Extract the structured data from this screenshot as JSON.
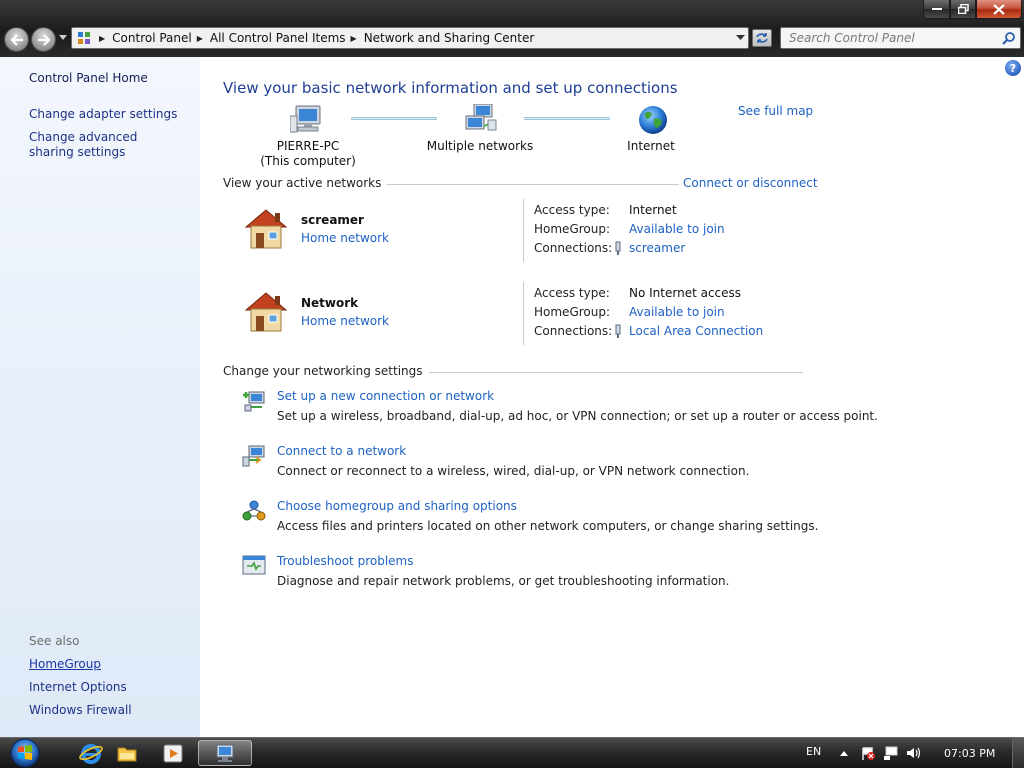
{
  "window": {
    "buttons": {
      "minimize": "minimize",
      "maximize": "restore",
      "close": "close"
    }
  },
  "address": {
    "crumbs": [
      "Control Panel",
      "All Control Panel Items",
      "Network and Sharing Center"
    ]
  },
  "search": {
    "placeholder": "Search Control Panel"
  },
  "sidebar": {
    "home": "Control Panel Home",
    "links": [
      "Change adapter settings",
      "Change advanced sharing settings"
    ],
    "see_also_title": "See also",
    "see_also": [
      "HomeGroup",
      "Internet Options",
      "Windows Firewall"
    ]
  },
  "main": {
    "heading": "View your basic network information and set up connections",
    "see_full_map": "See full map",
    "map": {
      "computer_name": "PIERRE-PC",
      "computer_sub": "(This computer)",
      "middle": "Multiple networks",
      "internet": "Internet"
    },
    "active_title": "View your active networks",
    "connect_disconnect": "Connect or disconnect",
    "networks": [
      {
        "name": "screamer",
        "type": "Home network",
        "access_label": "Access type:",
        "access": "Internet",
        "homegroup_label": "HomeGroup:",
        "homegroup": "Available to join",
        "connections_label": "Connections:",
        "connection": "screamer"
      },
      {
        "name": "Network",
        "type": "Home network",
        "access_label": "Access type:",
        "access": "No Internet access",
        "homegroup_label": "HomeGroup:",
        "homegroup": "Available to join",
        "connections_label": "Connections:",
        "connection": "Local Area Connection"
      }
    ],
    "settings_title": "Change your networking settings",
    "tasks": [
      {
        "title": "Set up a new connection or network",
        "desc": "Set up a wireless, broadband, dial-up, ad hoc, or VPN connection; or set up a router or access point.",
        "icon": "new-connection-icon"
      },
      {
        "title": "Connect to a network",
        "desc": "Connect or reconnect to a wireless, wired, dial-up, or VPN network connection.",
        "icon": "connect-network-icon"
      },
      {
        "title": "Choose homegroup and sharing options",
        "desc": "Access files and printers located on other network computers, or change sharing settings.",
        "icon": "homegroup-icon"
      },
      {
        "title": "Troubleshoot problems",
        "desc": "Diagnose and repair network problems, or get troubleshooting information.",
        "icon": "troubleshoot-icon"
      }
    ]
  },
  "taskbar": {
    "language": "EN",
    "clock": "07:03 PM",
    "pinned": [
      "internet-explorer-icon",
      "explorer-folder-icon",
      "media-player-icon",
      "network-center-icon"
    ]
  },
  "colors": {
    "link": "#1e62c4",
    "heading": "#1f3f94",
    "sidebar": "#e8eff9"
  }
}
